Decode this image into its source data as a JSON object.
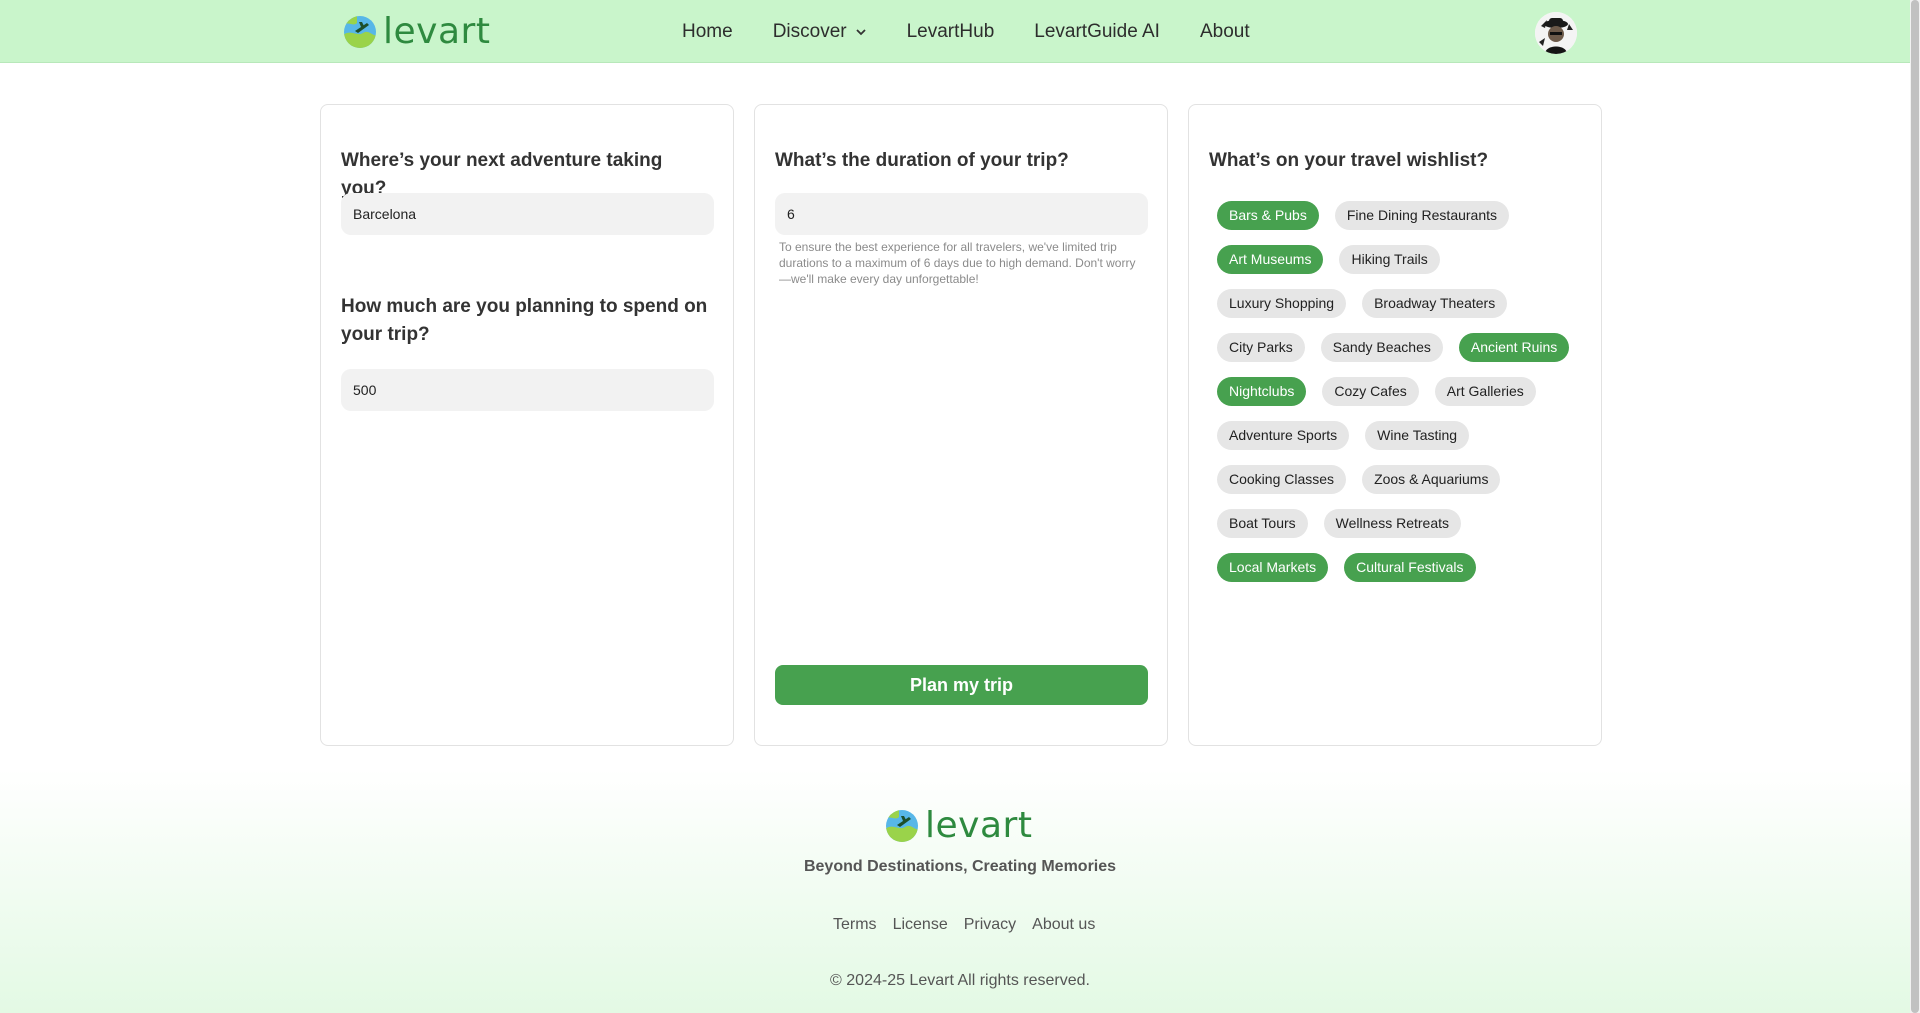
{
  "brand": {
    "name": "levart"
  },
  "nav": {
    "items": [
      {
        "label": "Home"
      },
      {
        "label": "Discover"
      },
      {
        "label": "LevartHub"
      },
      {
        "label": "LevartGuide AI"
      },
      {
        "label": "About"
      }
    ]
  },
  "destination": {
    "question": "Where’s your next adventure taking you?",
    "value": "Barcelona"
  },
  "budget": {
    "question": "How much are you planning to spend on your trip?",
    "value": "500"
  },
  "duration": {
    "question": "What’s the duration of your trip?",
    "value": "6",
    "hint": "To ensure the best experience for all travelers, we've limited trip durations to a maximum of 6 days due to high demand. Don't worry—we'll make every day unforgettable!"
  },
  "plan_button": {
    "label": "Plan my trip"
  },
  "wishlist": {
    "question": "What’s on your travel wishlist?",
    "rows": [
      [
        {
          "label": "Bars & Pubs",
          "selected": true
        },
        {
          "label": "Fine Dining Restaurants",
          "selected": false
        }
      ],
      [
        {
          "label": "Art Museums",
          "selected": true
        },
        {
          "label": "Hiking Trails",
          "selected": false
        }
      ],
      [
        {
          "label": "Luxury Shopping",
          "selected": false
        },
        {
          "label": "Broadway Theaters",
          "selected": false
        }
      ],
      [
        {
          "label": "City Parks",
          "selected": false
        },
        {
          "label": "Sandy Beaches",
          "selected": false
        },
        {
          "label": "Ancient Ruins",
          "selected": true
        }
      ],
      [
        {
          "label": "Nightclubs",
          "selected": true
        },
        {
          "label": "Cozy Cafes",
          "selected": false
        },
        {
          "label": "Art Galleries",
          "selected": false
        }
      ],
      [
        {
          "label": "Adventure Sports",
          "selected": false
        },
        {
          "label": "Wine Tasting",
          "selected": false
        }
      ],
      [
        {
          "label": "Cooking Classes",
          "selected": false
        },
        {
          "label": "Zoos & Aquariums",
          "selected": false
        }
      ],
      [
        {
          "label": "Boat Tours",
          "selected": false
        },
        {
          "label": "Wellness Retreats",
          "selected": false
        }
      ],
      [
        {
          "label": "Local Markets",
          "selected": true
        },
        {
          "label": "Cultural Festivals",
          "selected": true
        }
      ]
    ]
  },
  "footer": {
    "tagline": "Beyond Destinations, Creating Memories",
    "links": [
      "Terms",
      "License",
      "Privacy",
      "About us"
    ],
    "copyright": "© 2024-25 Levart All rights reserved."
  },
  "colors": {
    "accent": "#47a14f",
    "header_bg": "#c9f5cb",
    "chip_bg": "#e6e6e6"
  },
  "icons": {
    "logo": "globe-plane-icon",
    "discover": "chevron-down-icon",
    "avatar": "user-avatar"
  }
}
